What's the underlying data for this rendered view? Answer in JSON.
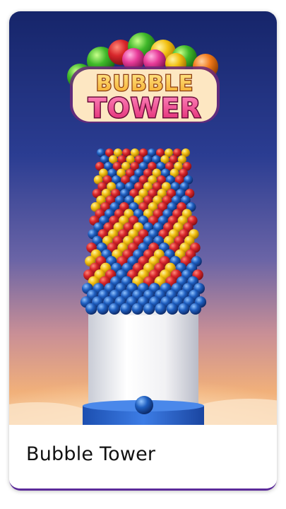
{
  "card": {
    "title": "Bubble Tower",
    "accent_color": "#5b2a9a"
  },
  "art": {
    "logo_line1": "BUBBLE",
    "logo_line2": "TOWER",
    "bubble_colors": [
      "#d8262b",
      "#f2c012",
      "#1f5fc0"
    ],
    "sky_top_color": "#17276b",
    "sky_bottom_color": "#f0b27a"
  }
}
